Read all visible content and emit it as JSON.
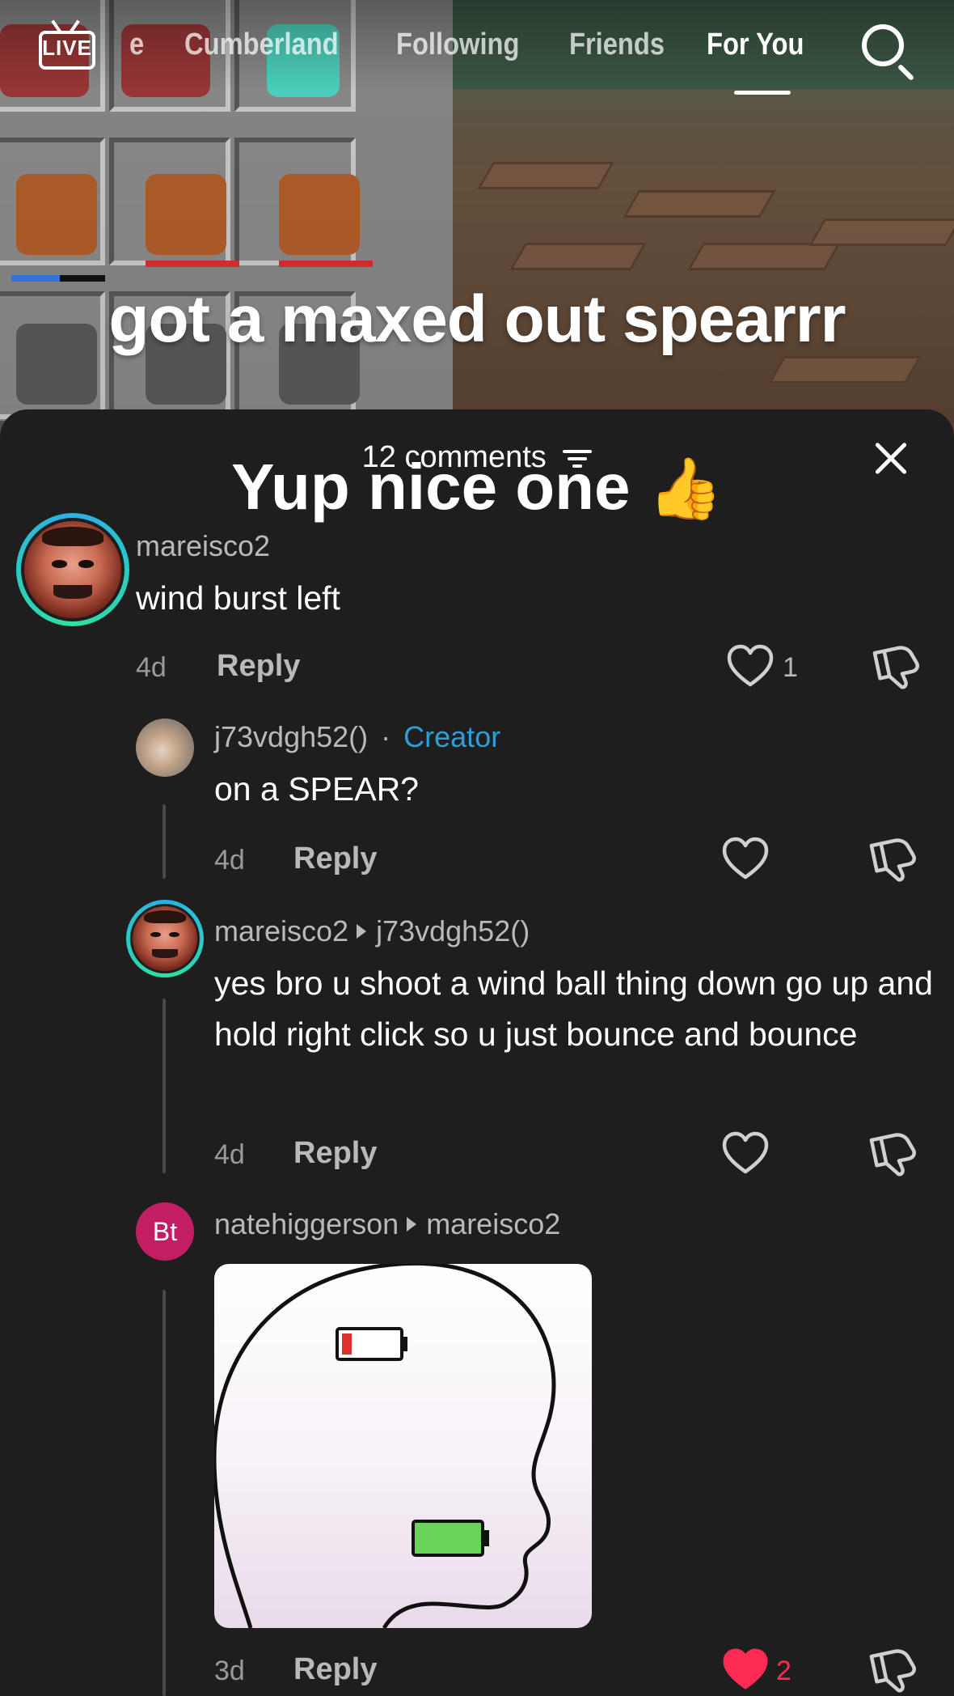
{
  "nav": {
    "live_label": "LIVE",
    "tabs": [
      {
        "label": "e",
        "active": false
      },
      {
        "label": "Cumberland",
        "active": false
      },
      {
        "label": "Following",
        "active": false
      },
      {
        "label": "Friends",
        "active": false
      },
      {
        "label": "For You",
        "active": true
      }
    ]
  },
  "video": {
    "caption": "got a maxed out spearrr"
  },
  "sticker": {
    "text": "Yup nice one",
    "emoji": "👍"
  },
  "comments_header": {
    "count_label": "12 comments"
  },
  "comments": [
    {
      "username": "mareisco2",
      "text": "wind burst left",
      "age": "4d",
      "reply_label": "Reply",
      "likes": "1",
      "liked": false
    },
    {
      "username": "j73vdgh52()",
      "separator": "·",
      "badge": "Creator",
      "text": "on a SPEAR?",
      "age": "4d",
      "reply_label": "Reply",
      "likes": "",
      "liked": false
    },
    {
      "username": "mareisco2",
      "reply_to": "j73vdgh52()",
      "text": "yes bro u shoot a wind ball thing down go up and hold right click so u just bounce and bounce",
      "age": "4d",
      "reply_label": "Reply",
      "likes": "",
      "liked": false
    },
    {
      "username": "natehiggerson",
      "avatar_initials": "Bt",
      "reply_to": "mareisco2",
      "text": "",
      "age": "3d",
      "reply_label": "Reply",
      "likes": "2",
      "liked": true
    }
  ],
  "colors": {
    "sheet_bg": "#1e1e1f",
    "creator_badge": "#2e9fd6",
    "liked_heart": "#fe2c55",
    "avatar_ring": "#2bb0e8",
    "initials_avatar": "#c21e63"
  },
  "icons": [
    "live-icon",
    "search-icon",
    "filter-icon",
    "close-icon",
    "heart-icon",
    "dislike-icon",
    "battery-low-icon",
    "battery-full-icon"
  ]
}
